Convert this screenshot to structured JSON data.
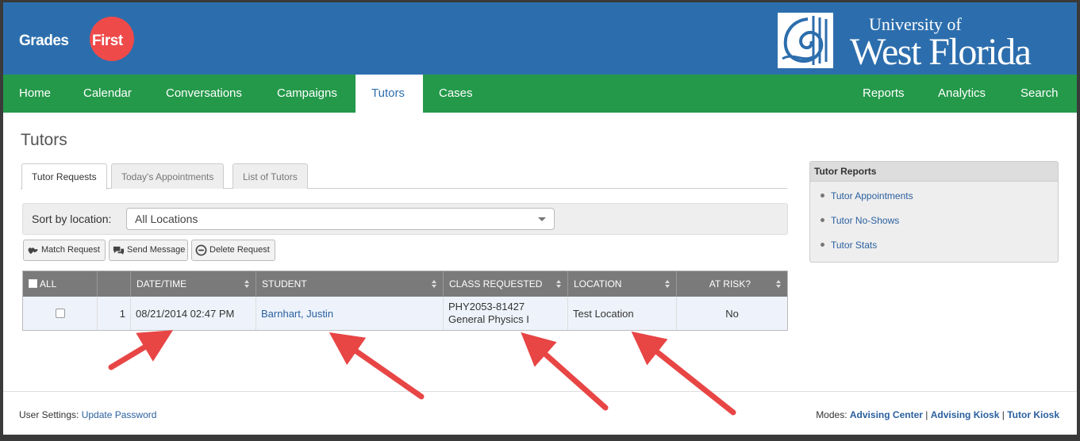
{
  "brand": {
    "logo_grades": "Grades",
    "logo_first": "First",
    "uni_small": "University of",
    "uni_big": "West Florida"
  },
  "nav": {
    "home": "Home",
    "calendar": "Calendar",
    "conversations": "Conversations",
    "campaigns": "Campaigns",
    "tutors": "Tutors",
    "cases": "Cases",
    "reports": "Reports",
    "analytics": "Analytics",
    "search": "Search"
  },
  "page": {
    "title": "Tutors"
  },
  "tabs": {
    "requests": "Tutor Requests",
    "today": "Today's Appointments",
    "list": "List of Tutors"
  },
  "filter": {
    "label": "Sort by location:",
    "value": "All Locations"
  },
  "actions": {
    "match": "Match Request",
    "send": "Send Message",
    "delete": "Delete Request"
  },
  "table": {
    "headers": {
      "all": "ALL",
      "datetime": "DATE/TIME",
      "student": "STUDENT",
      "class": "CLASS REQUESTED",
      "location": "LOCATION",
      "risk": "AT RISK?"
    },
    "rows": [
      {
        "num": "1",
        "datetime": "08/21/2014 02:47 PM",
        "student": "Barnhart, Justin",
        "class": "PHY2053-81427 General Physics I",
        "location": "Test Location",
        "risk": "No"
      }
    ]
  },
  "sidebar": {
    "title": "Tutor Reports",
    "items": [
      "Tutor Appointments",
      "Tutor No-Shows",
      "Tutor Stats"
    ]
  },
  "footer": {
    "settings_label": "User Settings:",
    "update_password": "Update Password",
    "modes_label": "Modes:",
    "advising_center": "Advising Center",
    "advising_kiosk": "Advising Kiosk",
    "tutor_kiosk": "Tutor Kiosk",
    "sep": "|"
  },
  "colors": {
    "header_blue": "#2c6ead",
    "nav_green": "#24994a",
    "logo_red": "#ef4a4a",
    "arrow_red": "#e84545",
    "link_blue": "#2a5f9e"
  }
}
